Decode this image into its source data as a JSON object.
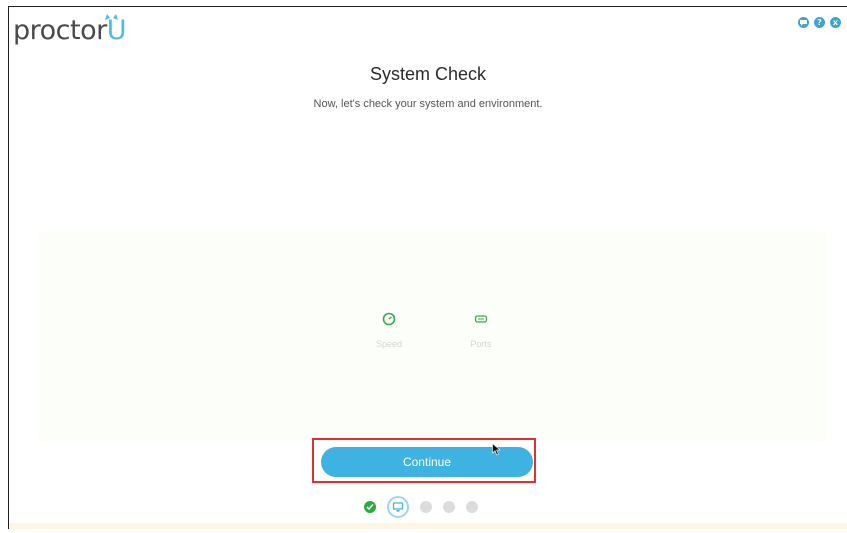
{
  "app": {
    "logo_text_main": "proctor",
    "logo_text_accent": "U"
  },
  "header": {
    "icons": [
      "chat-icon",
      "help-icon",
      "close-icon"
    ],
    "help_glyph": "?",
    "close_glyph": "x"
  },
  "main": {
    "title": "System Check",
    "subtitle": "Now, let's check your system and environment."
  },
  "checks": [
    {
      "label": "Speed",
      "icon": "speedometer-icon"
    },
    {
      "label": "Ports",
      "icon": "ports-icon"
    }
  ],
  "footer": {
    "continue_label": "Continue",
    "steps": [
      {
        "state": "done"
      },
      {
        "state": "current",
        "icon": "monitor-icon"
      },
      {
        "state": "pending"
      },
      {
        "state": "pending"
      },
      {
        "state": "pending"
      }
    ]
  },
  "colors": {
    "accent_blue": "#3eb3e2",
    "title_highlight": "#f3ec4a",
    "success_green": "#2eaa3c",
    "annotation_red": "#e03030"
  }
}
